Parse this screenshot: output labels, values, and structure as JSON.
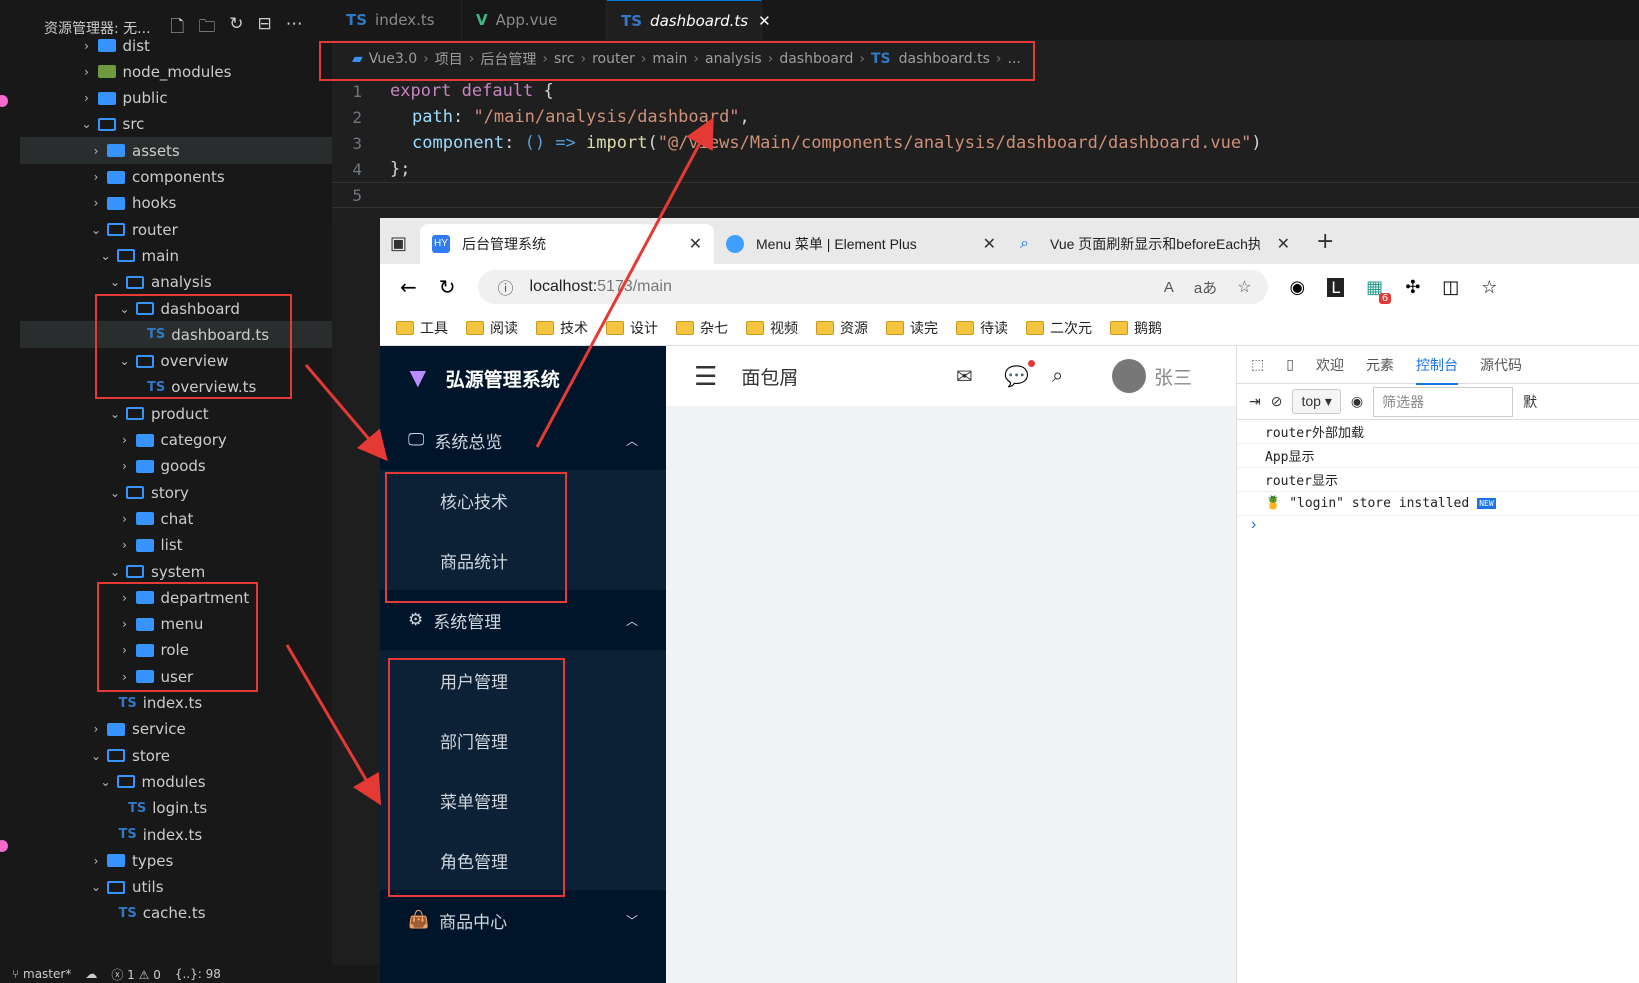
{
  "explorer": {
    "title": "资源管理器: 无...",
    "items": [
      {
        "label": "dist",
        "kind": "folder",
        "open": false
      },
      {
        "label": "node_modules",
        "kind": "node",
        "open": false
      },
      {
        "label": "public",
        "kind": "folder",
        "open": false
      },
      {
        "label": "src",
        "kind": "folder",
        "open": true
      },
      {
        "label": "assets",
        "kind": "folder",
        "open": false
      },
      {
        "label": "components",
        "kind": "folder",
        "open": false
      },
      {
        "label": "hooks",
        "kind": "folder",
        "open": false
      },
      {
        "label": "router",
        "kind": "folder",
        "open": true
      },
      {
        "label": "main",
        "kind": "folder",
        "open": true
      },
      {
        "label": "analysis",
        "kind": "folder",
        "open": true
      },
      {
        "label": "dashboard",
        "kind": "folder",
        "open": true
      },
      {
        "label": "dashboard.ts",
        "kind": "ts"
      },
      {
        "label": "overview",
        "kind": "folder",
        "open": true
      },
      {
        "label": "overview.ts",
        "kind": "ts"
      },
      {
        "label": "product",
        "kind": "folder",
        "open": true
      },
      {
        "label": "category",
        "kind": "folder",
        "open": false
      },
      {
        "label": "goods",
        "kind": "folder",
        "open": false
      },
      {
        "label": "story",
        "kind": "folder",
        "open": true
      },
      {
        "label": "chat",
        "kind": "folder",
        "open": false
      },
      {
        "label": "list",
        "kind": "folder",
        "open": false
      },
      {
        "label": "system",
        "kind": "folder",
        "open": true
      },
      {
        "label": "department",
        "kind": "folder",
        "open": false
      },
      {
        "label": "menu",
        "kind": "folder",
        "open": false
      },
      {
        "label": "role",
        "kind": "folder",
        "open": false
      },
      {
        "label": "user",
        "kind": "folder",
        "open": false
      },
      {
        "label": "index.ts",
        "kind": "ts"
      },
      {
        "label": "service",
        "kind": "folder",
        "open": false
      },
      {
        "label": "store",
        "kind": "folder",
        "open": true
      },
      {
        "label": "modules",
        "kind": "folder",
        "open": true
      },
      {
        "label": "login.ts",
        "kind": "ts"
      },
      {
        "label": "index.ts",
        "kind": "ts"
      },
      {
        "label": "types",
        "kind": "folder",
        "open": false
      },
      {
        "label": "utils",
        "kind": "folder",
        "open": true
      },
      {
        "label": "cache.ts",
        "kind": "ts"
      }
    ]
  },
  "statusbar": {
    "branch": "master*",
    "errors": "1",
    "warnings": "0",
    "braces": "{..}: 98"
  },
  "editor_tabs": [
    {
      "icon": "TS",
      "label": "index.ts"
    },
    {
      "icon": "V",
      "label": "App.vue"
    },
    {
      "icon": "TS",
      "label": "dashboard.ts",
      "close": "✕"
    }
  ],
  "breadcrumb": [
    "Vue3.0",
    "项目",
    "后台管理",
    "src",
    "router",
    "main",
    "analysis",
    "dashboard",
    "dashboard.ts",
    "..."
  ],
  "breadcrumb_ts": "TS",
  "code": {
    "line_numbers": [
      "1",
      "2",
      "3",
      "4",
      "5"
    ],
    "l1_kw": "export default",
    "l1_rest": " {",
    "l2_prop": "path",
    "l2_str": "\"/main/analysis/dashboard\"",
    "l3_prop": "component",
    "l3_arrow": "() =>",
    "l3_fn": "import",
    "l3_str": "\"@/views/Main/components/analysis/dashboard/dashboard.vue\"",
    "l4": "};"
  },
  "browser": {
    "tabs": [
      {
        "icon": "HY",
        "label": "后台管理系统"
      },
      {
        "icon": "",
        "label": "Menu 菜单 | Element Plus"
      },
      {
        "icon": "",
        "label": "Vue 页面刷新显示和beforeEach执"
      }
    ],
    "url_host": "localhost:",
    "url_rest": "5173/main",
    "read_aloud": "A",
    "translate": "aあ",
    "ext_badge": "6",
    "bookmarks": [
      "工具",
      "阅读",
      "技术",
      "设计",
      "杂七",
      "视频",
      "资源",
      "读完",
      "待读",
      "二次元",
      "鹅鹅"
    ]
  },
  "app": {
    "logo_text": "弘源管理系统",
    "menus": [
      {
        "label": "系统总览",
        "icon": "monitor-icon",
        "arrow": "︿",
        "children": [
          "核心技术",
          "商品统计"
        ]
      },
      {
        "label": "系统管理",
        "icon": "gear-icon",
        "arrow": "︿",
        "children": [
          "用户管理",
          "部门管理",
          "菜单管理",
          "角色管理"
        ]
      },
      {
        "label": "商品中心",
        "icon": "bag-icon",
        "arrow": "﹀",
        "children": []
      }
    ],
    "breadcrumb": "面包屑",
    "username": "张三"
  },
  "devtools": {
    "tabs": [
      "欢迎",
      "元素",
      "控制台",
      "源代码"
    ],
    "active_tab": "控制台",
    "context": "top",
    "filter_placeholder": "筛选器",
    "default_levels": "默",
    "logs": [
      "router外部加载",
      "App显示",
      "router显示",
      "\"login\" store installed"
    ],
    "new_badge": "NEW",
    "prompt": "›"
  },
  "colors": {
    "annotation": "#e53935",
    "menu_bg": "#001529",
    "accent": "#1a73e8"
  }
}
